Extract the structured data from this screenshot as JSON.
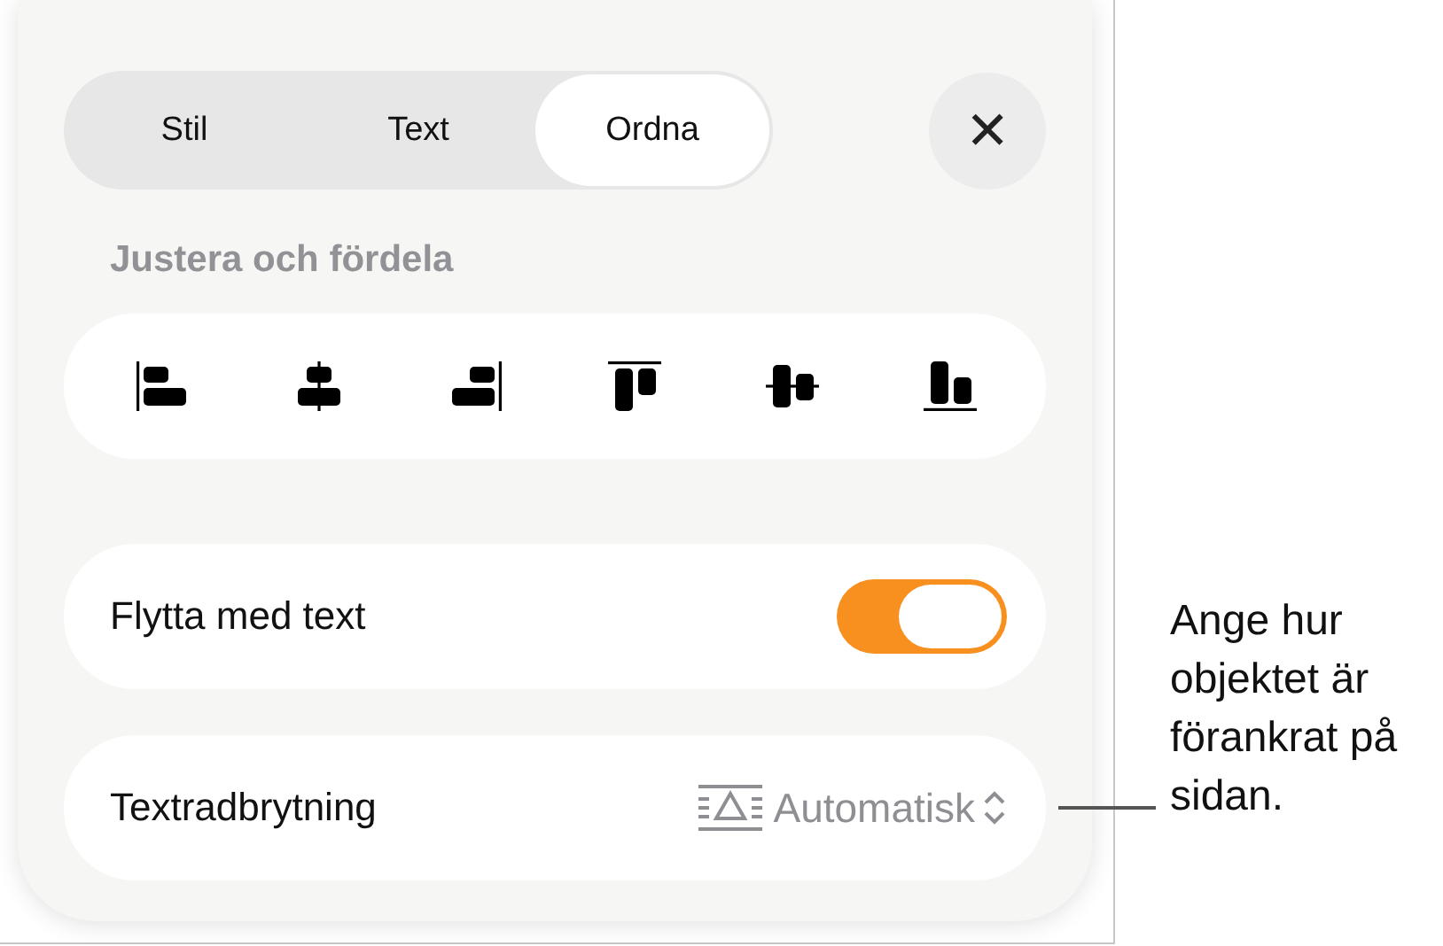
{
  "tabs": [
    {
      "label": "Stil",
      "selected": false
    },
    {
      "label": "Text",
      "selected": false
    },
    {
      "label": "Ordna",
      "selected": true
    }
  ],
  "close": {
    "glyph": "✕"
  },
  "section_heading": "Justera och fördela",
  "align_buttons": [
    {
      "kind": "left"
    },
    {
      "kind": "hcenter"
    },
    {
      "kind": "right"
    },
    {
      "kind": "top"
    },
    {
      "kind": "vmiddle"
    },
    {
      "kind": "bottom"
    }
  ],
  "rows": [
    {
      "kind": "toggle",
      "label": "Flytta med text",
      "on": true
    },
    {
      "kind": "popup",
      "label": "Textradbrytning",
      "value": "Automatisk"
    }
  ],
  "callout": "Ange hur objektet är förankrat på sidan."
}
